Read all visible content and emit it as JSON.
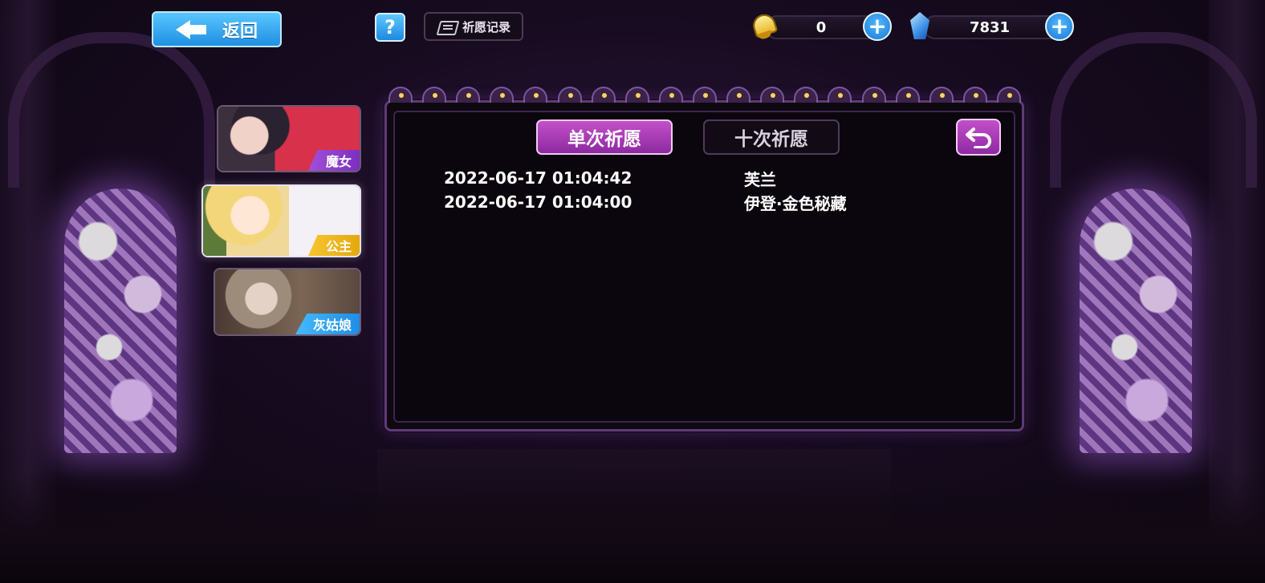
{
  "top_bar": {
    "back_label": "返回",
    "help_label": "?",
    "records_label": "祈愿记录"
  },
  "currencies": [
    {
      "icon": "bell-icon",
      "amount": "0"
    },
    {
      "icon": "crystal-icon",
      "amount": "7831"
    }
  ],
  "character_tabs": [
    {
      "label": "魔女",
      "tag_color": "#8f3fcd"
    },
    {
      "label": "公主",
      "tag_color": "#eeb41c",
      "selected": true
    },
    {
      "label": "灰姑娘",
      "tag_color": "#2f9cee"
    }
  ],
  "panel": {
    "tabs": [
      {
        "label": "单次祈愿",
        "active": true
      },
      {
        "label": "十次祈愿",
        "active": false
      }
    ],
    "records": [
      {
        "time": "2022-06-17 01:04:42",
        "item": "芙兰"
      },
      {
        "time": "2022-06-17 01:04:00",
        "item": "伊登·金色秘藏"
      }
    ]
  },
  "colors": {
    "accent_purple": "#a63cb8",
    "button_blue": "#2b9de8"
  }
}
